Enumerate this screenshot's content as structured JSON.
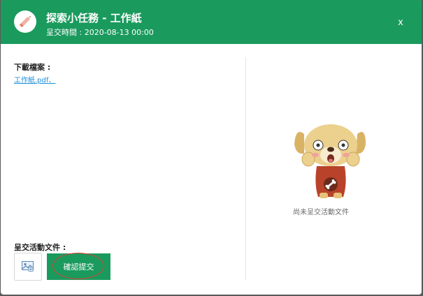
{
  "header": {
    "icon": "pencil-icon",
    "title": "探索小任務 - 工作紙",
    "due_date": "呈交時間 : 2020-08-13 00:00",
    "close_label": "x"
  },
  "left_pane": {
    "download_label": "下載檔案 :",
    "file_link": "工作紙.pdf",
    "file_separator": "、",
    "submit_section_label": "呈交活動文件 :",
    "upload_icon": "image-upload-icon",
    "submit_button_label": "確認提交"
  },
  "right_pane": {
    "mascot": "surprised-dog-mascot",
    "empty_message": "尚未呈交活動文件"
  },
  "colors": {
    "header_bg": "#1b9a5e",
    "link": "#1a8ed8",
    "annotation_circle": "#e23b2e"
  }
}
